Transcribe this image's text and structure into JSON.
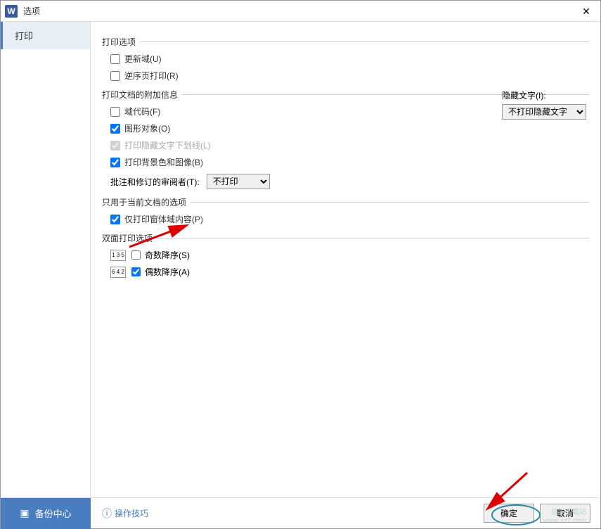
{
  "window": {
    "title": "选项",
    "close_icon": "✕",
    "app_icon_text": "W"
  },
  "sidebar": {
    "items": [
      {
        "label": "打印"
      }
    ]
  },
  "groups": {
    "print_options": {
      "title": "打印选项",
      "update_fields": "更新域(U)",
      "reverse_print": "逆序页打印(R)"
    },
    "additional_info": {
      "title": "打印文档的附加信息",
      "field_codes": "域代码(F)",
      "graphics": "图形对象(O)",
      "hidden_underline": "打印隐藏文字下划线(L)",
      "background": "打印背景色和图像(B)",
      "hidden_text_label": "隐藏文字(I):",
      "hidden_text_value": "不打印隐藏文字",
      "reviewer_label": "批注和修订的审阅者(T):",
      "reviewer_value": "不打印"
    },
    "current_doc": {
      "title": "只用于当前文档的选项",
      "form_content": "仅打印窗体域内容(P)"
    },
    "duplex": {
      "title": "双面打印选项",
      "odd_desc": "奇数降序(S)",
      "even_desc": "偶数降序(A)",
      "odd_icon": "1 3 5",
      "even_icon": "6 4 2"
    }
  },
  "checks": {
    "update_fields": false,
    "reverse_print": false,
    "field_codes": false,
    "graphics": true,
    "hidden_underline": true,
    "background": true,
    "form_content": true,
    "odd_desc": false,
    "even_desc": true
  },
  "bottom": {
    "backup": "备份中心",
    "tips": "操作技巧",
    "ok": "确定",
    "cancel": "取消"
  },
  "watermark": {
    "line1": "极光下载站",
    "line2": "www.xz7.com"
  }
}
